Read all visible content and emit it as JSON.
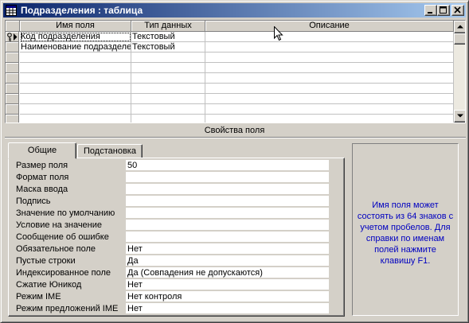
{
  "window": {
    "title": "Подразделения : таблица"
  },
  "grid": {
    "columns": [
      "Имя поля",
      "Тип данных",
      "Описание"
    ],
    "rows": [
      {
        "name": "Код подразделения",
        "type": "Текстовый",
        "description": "",
        "key": true,
        "current": true
      },
      {
        "name": "Наименование подразделения",
        "type": "Текстовый",
        "description": "",
        "key": false,
        "current": false
      }
    ]
  },
  "properties": {
    "title": "Свойства поля",
    "tabs": [
      "Общие",
      "Подстановка"
    ],
    "active_tab": 0,
    "fields": [
      {
        "label": "Размер поля",
        "value": "50"
      },
      {
        "label": "Формат поля",
        "value": ""
      },
      {
        "label": "Маска ввода",
        "value": ""
      },
      {
        "label": "Подпись",
        "value": ""
      },
      {
        "label": "Значение по умолчанию",
        "value": ""
      },
      {
        "label": "Условие на значение",
        "value": ""
      },
      {
        "label": "Сообщение об ошибке",
        "value": ""
      },
      {
        "label": "Обязательное поле",
        "value": "Нет"
      },
      {
        "label": "Пустые строки",
        "value": "Да"
      },
      {
        "label": "Индексированное поле",
        "value": "Да (Совпадения не допускаются)"
      },
      {
        "label": "Сжатие Юникод",
        "value": "Нет"
      },
      {
        "label": "Режим IME",
        "value": "Нет контроля"
      },
      {
        "label": "Режим предложений IME",
        "value": "Нет"
      }
    ],
    "help_text": "Имя поля может состоять из 64 знаков с учетом пробелов.  Для справки по именам полей нажмите клавишу F1."
  },
  "colors": {
    "title_start": "#0a246a",
    "title_end": "#a6caf0",
    "help_text": "#0000c0",
    "face": "#d4d0c8"
  },
  "icons": {
    "window": "table-icon",
    "minimize": "minimize-icon",
    "maximize": "maximize-icon",
    "close": "close-icon",
    "primary_key": "key-icon",
    "row_pointer": "row-pointer-icon",
    "scroll_up": "scroll-up-arrow-icon",
    "scroll_down": "scroll-down-arrow-icon",
    "cursor": "mouse-cursor-icon"
  }
}
